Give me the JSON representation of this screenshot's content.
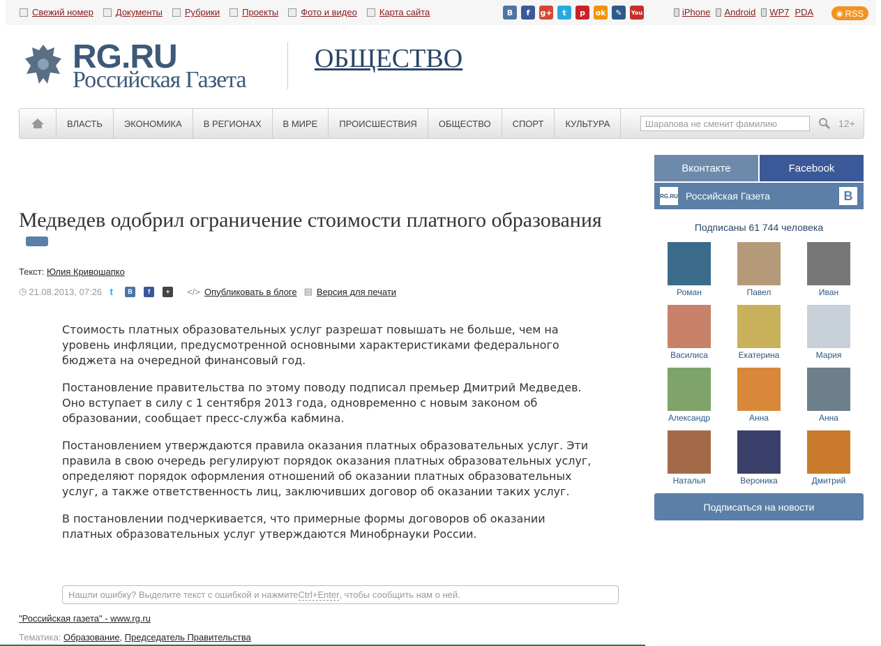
{
  "topbar": {
    "links": [
      "Свежий номер",
      "Документы",
      "Рубрики",
      "Проекты",
      "Фото и видео",
      "Карта сайта"
    ],
    "social": [
      {
        "icon": "vk-icon",
        "glyph": "В",
        "color": "#4c75a3"
      },
      {
        "icon": "facebook-icon",
        "glyph": "f",
        "color": "#3b5998"
      },
      {
        "icon": "googleplus-icon",
        "glyph": "g+",
        "color": "#d34836"
      },
      {
        "icon": "twitter-icon",
        "glyph": "t",
        "color": "#2aa9e0"
      },
      {
        "icon": "pinterest-icon",
        "glyph": "p",
        "color": "#cb2027"
      },
      {
        "icon": "odnoklassniki-icon",
        "glyph": "ok",
        "color": "#f29400"
      },
      {
        "icon": "livejournal-icon",
        "glyph": "✎",
        "color": "#2c5a8a"
      },
      {
        "icon": "youtube-icon",
        "glyph": "You",
        "color": "#c4302b"
      }
    ],
    "devices": [
      "iPhone",
      "Android",
      "WP7",
      "PDA"
    ],
    "rss": "RSS"
  },
  "header": {
    "logo_main": "RG.RU",
    "logo_sub": "Российская Газета",
    "section": "ОБЩЕСТВО"
  },
  "nav": {
    "items": [
      "ВЛАСТЬ",
      "ЭКОНОМИКА",
      "В РЕГИОНАХ",
      "В МИРЕ",
      "ПРОИСШЕСТВИЯ",
      "ОБЩЕСТВО",
      "СПОРТ",
      "КУЛЬТУРА"
    ],
    "search_placeholder": "Шарапова не сменит фамилию",
    "age": "12+"
  },
  "article": {
    "title": "Медведев одобрил ограничение стоимости платного образования",
    "byline_label": "Текст:",
    "author": "Юлия Кривошапко",
    "datetime": "21.08.2013, 07:26",
    "blog_link": "Опубликовать в блоге",
    "print_link": "Версия для печати",
    "paragraphs": [
      "Стоимость платных образовательных услуг разрешат повышать не больше, чем на уровень инфляции, предусмотренной основными характеристиками федерального бюджета на очередной финансовый год.",
      "Постановление правительства по этому поводу подписал премьер Дмитрий Медведев. Оно вступает в силу с 1 сентября 2013 года, одновременно с новым законом об образовании, сообщает пресс-служба кабмина.",
      "Постановлением утверждаются правила оказания платных образовательных услуг. Эти правила в свою очередь регулируют порядок оказания платных образовательных услуг, определяют порядок оформления отношений об оказании платных образовательных услуг, а также ответственность лиц, заключивших договор об оказании таких услуг.",
      "В постановлении подчеркивается, что примерные формы договоров об оказании платных образовательных услуг утверждаются Минобрнауки России."
    ],
    "error_pre": "Нашли ошибку? Выделите текст с ошибкой и нажмите ",
    "error_key": "Ctrl+Enter",
    "error_post": ", чтобы сообщить нам о ней.",
    "source": "\"Российская газета\" - www.rg.ru",
    "tags_label": "Тематика:",
    "tags": [
      "Образование",
      "Председатель Правительства"
    ]
  },
  "widget": {
    "tab_vk": "Вконтакте",
    "tab_fb": "Facebook",
    "group": "Российская Газета",
    "group_logo": "RG.RU",
    "subscribed": "Подписаны 61 744 человека",
    "members": [
      {
        "name": "Роман",
        "color": "#3b6b8a"
      },
      {
        "name": "Павел",
        "color": "#b59a7a"
      },
      {
        "name": "Иван",
        "color": "#777777"
      },
      {
        "name": "Василиса",
        "color": "#c9826a"
      },
      {
        "name": "Екатерина",
        "color": "#c8b15a"
      },
      {
        "name": "Мария",
        "color": "#c8d0da"
      },
      {
        "name": "Александр",
        "color": "#7ea36b"
      },
      {
        "name": "Анна",
        "color": "#d9883a"
      },
      {
        "name": "Анна",
        "color": "#6d7f8a"
      },
      {
        "name": "Наталья",
        "color": "#a36a4a"
      },
      {
        "name": "Вероника",
        "color": "#3a3f6a"
      },
      {
        "name": "Дмитрий",
        "color": "#c97a2a"
      }
    ],
    "subscribe_button": "Подписаться на новости"
  }
}
